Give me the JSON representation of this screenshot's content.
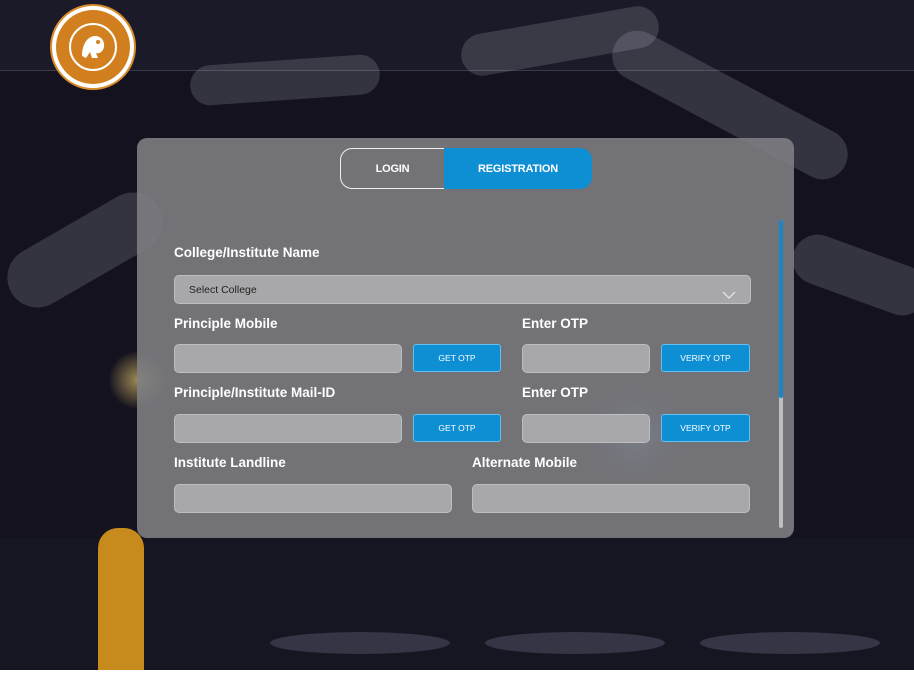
{
  "logo": {
    "name": "institute-emblem"
  },
  "tabs": {
    "login": "LOGIN",
    "registration": "REGISTRATION",
    "active": "registration"
  },
  "form": {
    "college_label": "College/Institute Name",
    "college_select_value": "Select College",
    "principal_mobile_label": "Principle Mobile",
    "mobile_otp_label": "Enter OTP",
    "mail_label": "Principle/Institute Mail-ID",
    "mail_otp_label": "Enter OTP",
    "landline_label": "Institute Landline",
    "alternate_mobile_label": "Alternate Mobile",
    "get_otp_label": "GET OTP",
    "verify_otp_label": "VERIFY OTP"
  },
  "colors": {
    "accent": "#0e8fd4",
    "logo": "#d2801f"
  }
}
